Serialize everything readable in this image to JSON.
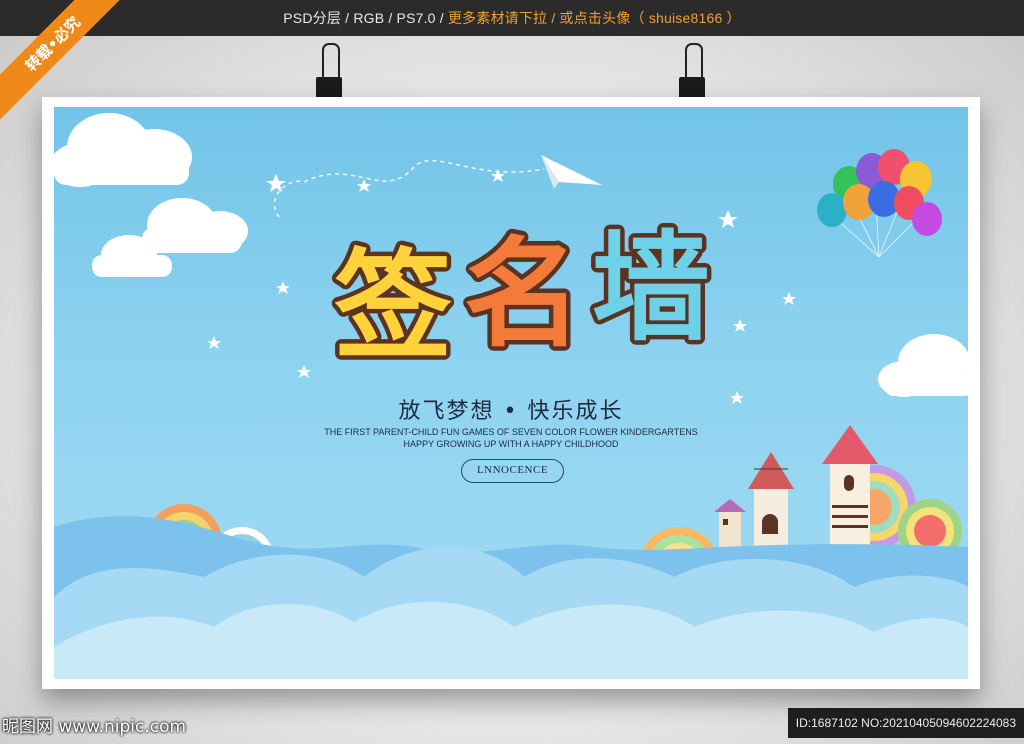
{
  "topbar": {
    "spec": "PSD分层 / RGB / PS7.0 /",
    "more": "更多素材请下拉 / 或点击头像（ shuise8166 ）"
  },
  "ribbon": {
    "label": "转载•必究"
  },
  "poster": {
    "title_chars": [
      "签",
      "名",
      "墙"
    ],
    "subtitle": "放飞梦想 • 快乐成长",
    "english_line1": "THE FIRST PARENT-CHILD FUN GAMES OF SEVEN COLOR FLOWER KINDERGARTENS",
    "english_line2": "HAPPY GROWING UP WITH A HAPPY CHILDHOOD",
    "badge": "LNNOCENCE"
  },
  "footer": {
    "site": "昵图网 www.nipic.com",
    "id": "ID:1687102 NO:20210405094602224083"
  },
  "colors": {
    "sky": "#8ed3f0",
    "title_yellow": "#ffd23c",
    "title_orange": "#f47a3a",
    "title_blue": "#6fd1e8",
    "title_outline": "#5a3322",
    "ribbon": "#ef8a18"
  },
  "icons": [
    "paper-plane-icon",
    "balloons-icon",
    "star-icon",
    "cloud-icon",
    "castle-icon"
  ]
}
